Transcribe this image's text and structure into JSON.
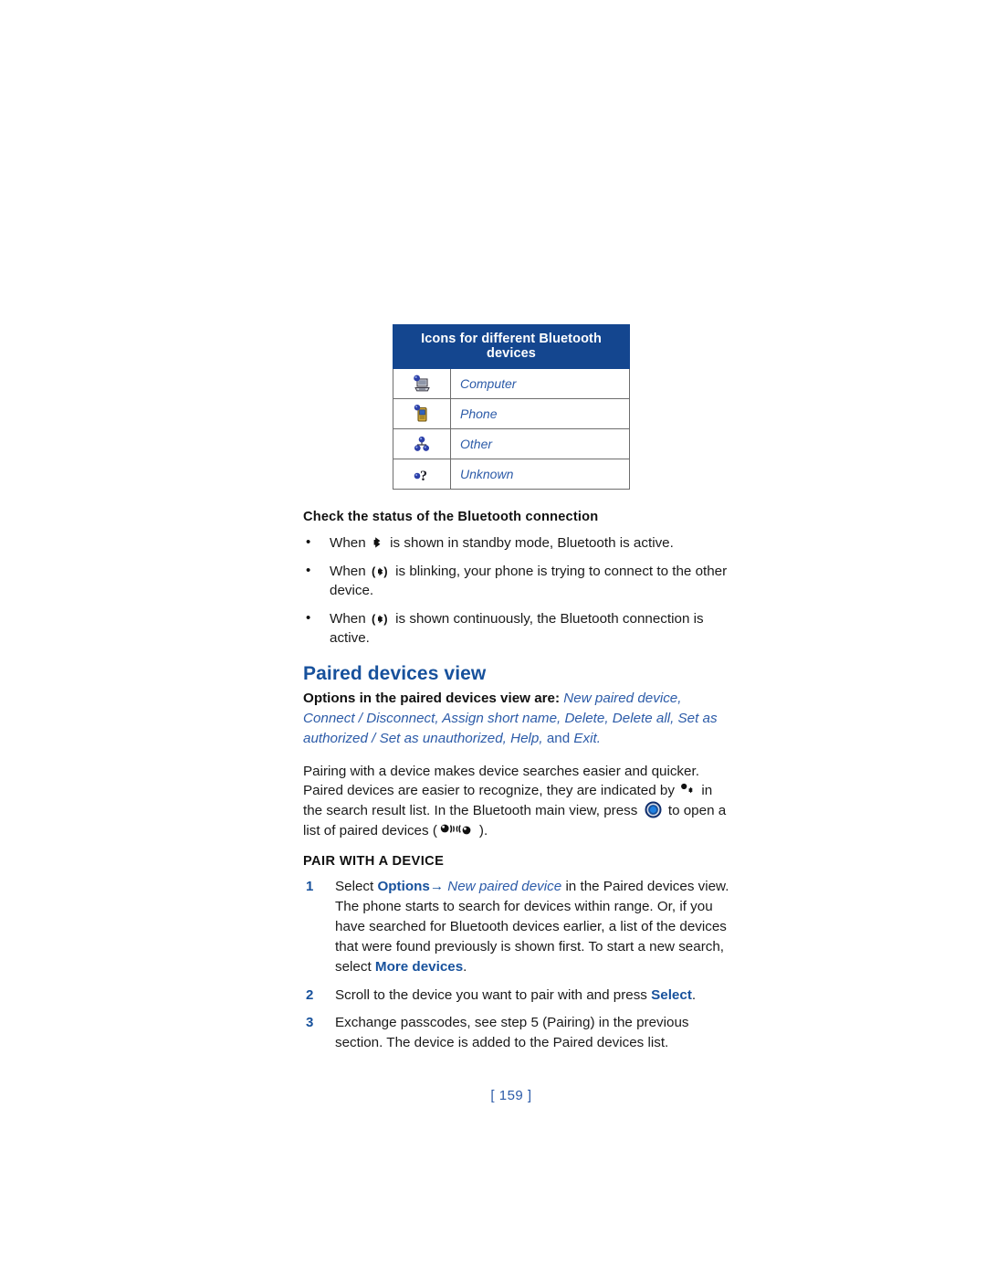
{
  "document": {
    "page_number": "[ 159 ]"
  },
  "icon_table": {
    "header": "Icons for different Bluetooth devices",
    "rows": [
      {
        "icon": "computer-device-icon",
        "label": "Computer"
      },
      {
        "icon": "phone-device-icon",
        "label": "Phone"
      },
      {
        "icon": "other-device-icon",
        "label": "Other"
      },
      {
        "icon": "unknown-device-icon",
        "label": "Unknown"
      }
    ]
  },
  "status_section": {
    "heading": "Check the status of the Bluetooth connection",
    "bullets": [
      {
        "before": "When",
        "icon": "bluetooth-standby-icon",
        "after": "is shown in standby mode, Bluetooth is active."
      },
      {
        "before": "When",
        "icon": "bluetooth-connecting-icon",
        "after": "is blinking, your phone is trying to connect to the other device."
      },
      {
        "before": "When",
        "icon": "bluetooth-connected-icon",
        "after": "is shown continuously, the Bluetooth connection is active."
      }
    ]
  },
  "paired_section": {
    "heading": "Paired devices view",
    "options_lead": "Options in the paired devices view are:",
    "options_list": "New paired device, Connect / Disconnect, Assign short name, Delete, Delete all, Set as authorized / Set as unauthorized, Help,",
    "options_and": "and",
    "options_last": "Exit.",
    "paragraph_part1": "Pairing with a device makes device searches easier and quicker. Paired devices are easier to recognize, they are indicated by",
    "paragraph_part2": "in the search result list. In the Bluetooth main view, press",
    "paragraph_part3": "to open a list of paired devices (",
    "paragraph_part4": ")."
  },
  "pair_section": {
    "heading": "PAIR WITH A DEVICE",
    "steps": [
      {
        "num": "1",
        "text_1": "Select",
        "bold_1": "Options",
        "arrow": "→",
        "ital_1": "New paired device",
        "text_2": "in the Paired devices view. The phone starts to search for devices within range. Or, if you have searched for Bluetooth devices earlier, a list of the devices that were found previously is shown first. To start a new search, select",
        "bold_2": "More devices",
        "text_3": "."
      },
      {
        "num": "2",
        "text_1": "Scroll to the device you want to pair with and press",
        "bold_1": "Select",
        "text_2": "."
      },
      {
        "num": "3",
        "text_1": "Exchange passcodes, see step 5 (Pairing) in the previous section. The device is added to the Paired devices list.",
        "bold_1": "",
        "text_2": ""
      }
    ]
  },
  "colors": {
    "table_header_bg": "#14468f",
    "heading_blue": "#17519c",
    "italic_blue": "#2c5ba8",
    "text_black": "#1a1a1a",
    "table_border": "#6d6d6d"
  }
}
